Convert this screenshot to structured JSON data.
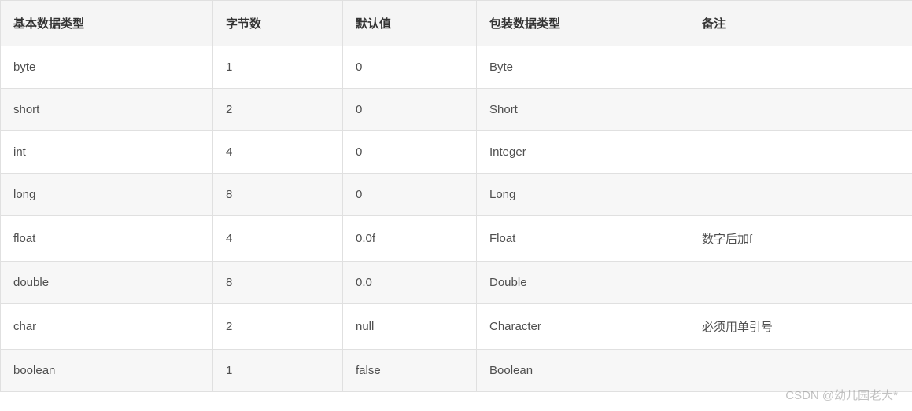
{
  "table": {
    "headers": [
      "基本数据类型",
      "字节数",
      "默认值",
      "包装数据类型",
      "备注"
    ],
    "rows": [
      {
        "c0": "byte",
        "c1": "1",
        "c2": "0",
        "c3": "Byte",
        "c4": ""
      },
      {
        "c0": "short",
        "c1": "2",
        "c2": "0",
        "c3": "Short",
        "c4": ""
      },
      {
        "c0": "int",
        "c1": "4",
        "c2": "0",
        "c3": "Integer",
        "c4": ""
      },
      {
        "c0": "long",
        "c1": "8",
        "c2": "0",
        "c3": "Long",
        "c4": ""
      },
      {
        "c0": "float",
        "c1": "4",
        "c2": "0.0f",
        "c3": "Float",
        "c4": "数字后加f"
      },
      {
        "c0": "double",
        "c1": "8",
        "c2": "0.0",
        "c3": "Double",
        "c4": ""
      },
      {
        "c0": "char",
        "c1": "2",
        "c2": "null",
        "c3": "Character",
        "c4": "必须用单引号"
      },
      {
        "c0": "boolean",
        "c1": "1",
        "c2": "false",
        "c3": "Boolean",
        "c4": ""
      }
    ]
  },
  "watermark": "CSDN @幼儿园老大*"
}
